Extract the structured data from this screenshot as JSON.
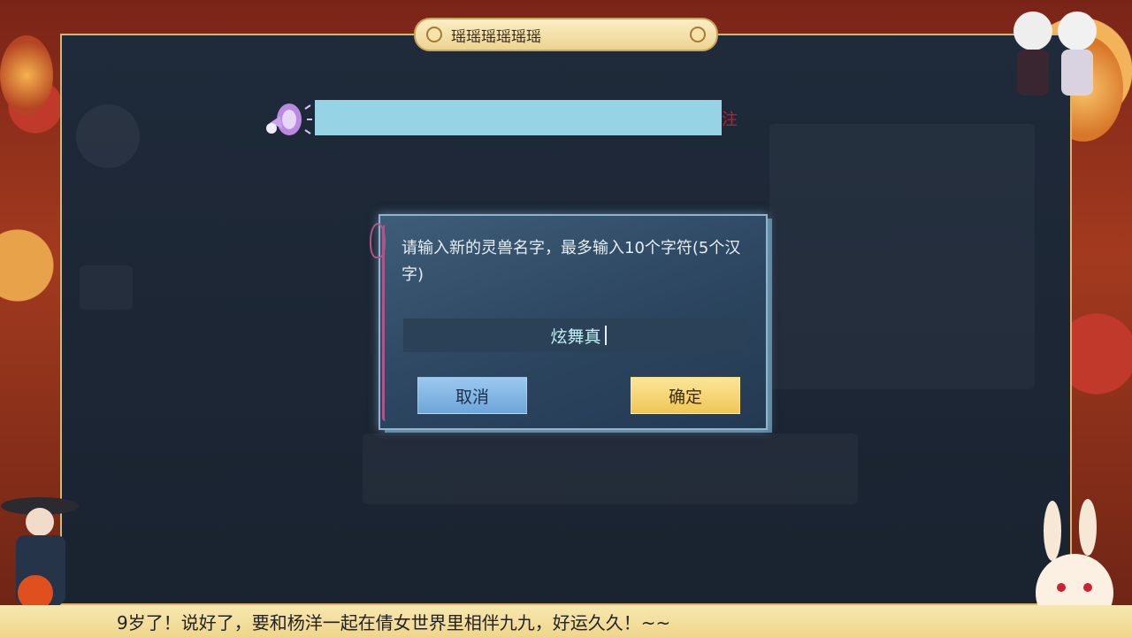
{
  "title_tab": {
    "label": "瑶瑶瑶瑶瑶瑶"
  },
  "announcement": {
    "tail_text": "注"
  },
  "dialog": {
    "prompt": "请输入新的灵兽名字，最多输入10个字符(5个汉字)",
    "input_value": "炫舞真",
    "cancel_label": "取消",
    "confirm_label": "确定"
  },
  "ticker": {
    "text": "9岁了！说好了，要和杨洋一起在倩女世界里相伴九九，好运久久！~~"
  },
  "colors": {
    "announce_bar": "#96d3e4",
    "confirm": "#f0c654",
    "cancel": "#6ea5d8",
    "accent_red": "#e0102a"
  }
}
